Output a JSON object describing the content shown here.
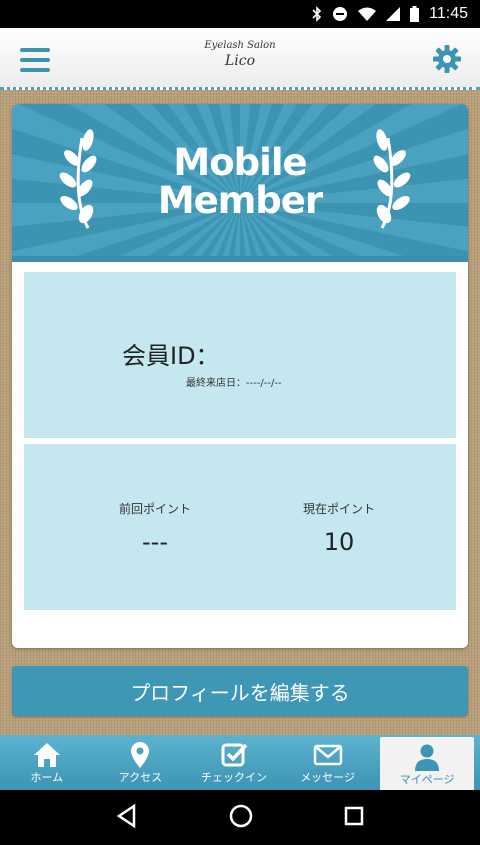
{
  "status_bar": {
    "time": "11:45"
  },
  "header": {
    "brand_top": "Eyelash Salon",
    "brand_main": "Lico",
    "accent_color": "#3d93b4"
  },
  "card": {
    "banner_line1": "Mobile",
    "banner_line2": "Member",
    "member_id_label": "会員ID：",
    "last_visit": "最終来店日：----/--/--",
    "previous_points_label": "前回ポイント",
    "previous_points_value": "---",
    "current_points_label": "現在ポイント",
    "current_points_value": "10"
  },
  "edit_button": {
    "label": "プロフィールを編集する"
  },
  "tabs": [
    {
      "label": "ホーム",
      "icon": "home-icon"
    },
    {
      "label": "アクセス",
      "icon": "map-pin-icon"
    },
    {
      "label": "チェックイン",
      "icon": "checkin-icon"
    },
    {
      "label": "メッセージ",
      "icon": "envelope-icon"
    },
    {
      "label": "マイページ",
      "icon": "user-icon",
      "active": true
    }
  ],
  "system_nav": {
    "back": "back-icon",
    "home": "home-circle-icon",
    "recents": "recents-icon"
  }
}
